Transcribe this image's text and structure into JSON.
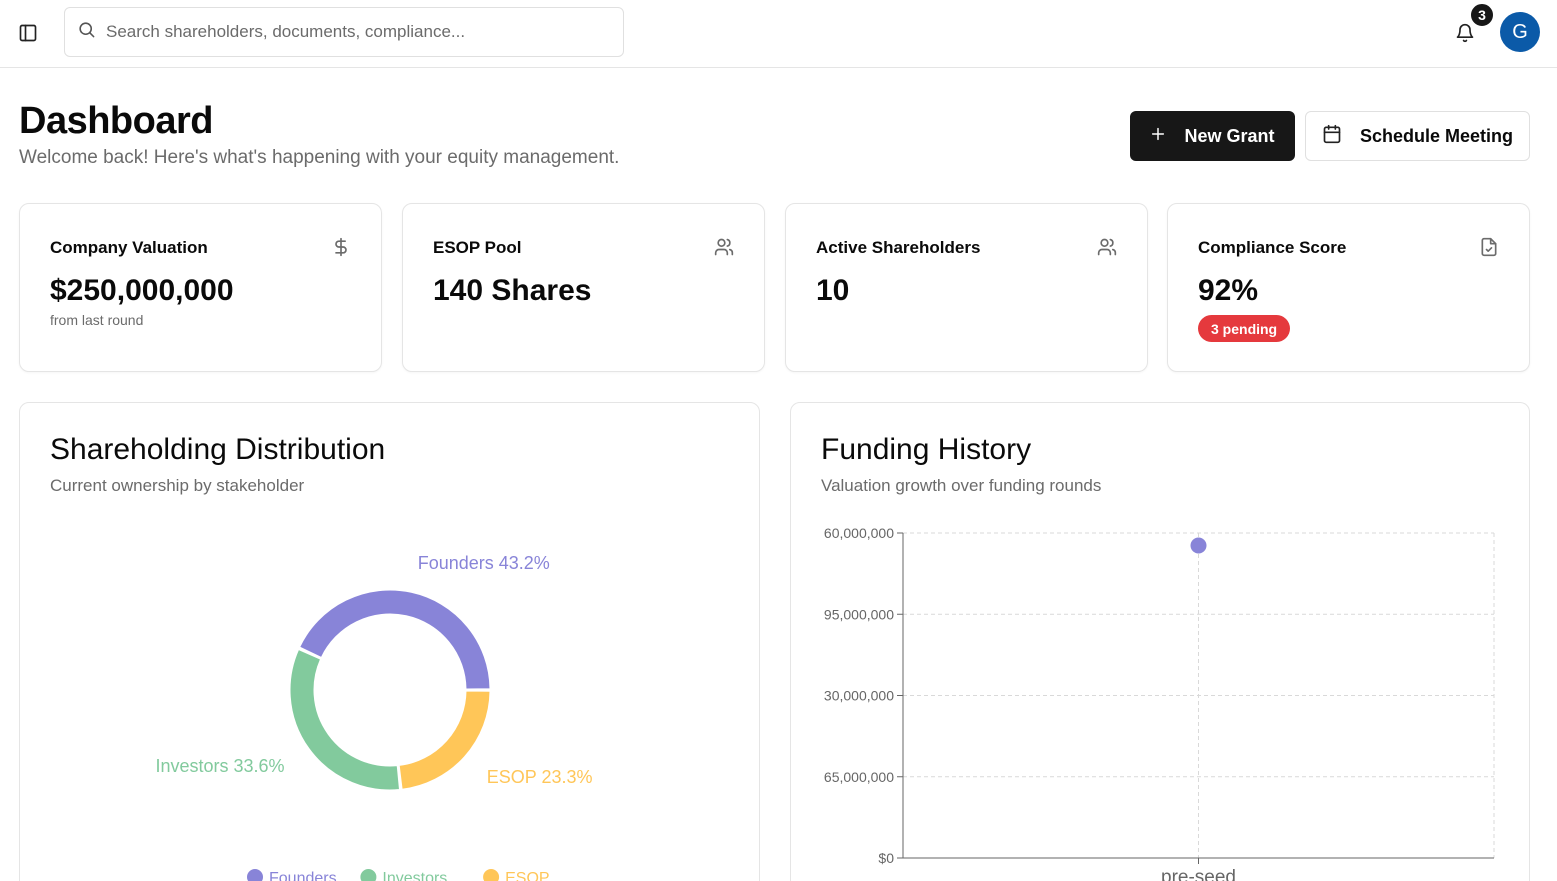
{
  "header": {
    "search_placeholder": "Search shareholders, documents, compliance...",
    "notification_count": "3",
    "avatar_initial": "G"
  },
  "page": {
    "title": "Dashboard",
    "subtitle": "Welcome back! Here's what's happening with your equity management.",
    "new_grant_label": "New Grant",
    "schedule_meeting_label": "Schedule Meeting"
  },
  "stats": [
    {
      "label": "Company Valuation",
      "value": "$250,000,000",
      "note": "from last round",
      "icon": "dollar-icon"
    },
    {
      "label": "ESOP Pool",
      "value": "140 Shares",
      "icon": "users-icon"
    },
    {
      "label": "Active Shareholders",
      "value": "10",
      "icon": "users-icon"
    },
    {
      "label": "Compliance Score",
      "value": "92%",
      "badge": "3 pending",
      "icon": "file-check-icon"
    }
  ],
  "colors": {
    "primary": "#171717",
    "danger": "#e5393d",
    "founders": "#8884d8",
    "investors": "#82ca9d",
    "esop": "#ffc658",
    "avatar": "#0b5aa8"
  },
  "panels": {
    "distribution": {
      "title": "Shareholding Distribution",
      "subtitle": "Current ownership by stakeholder"
    },
    "funding": {
      "title": "Funding History",
      "subtitle": "Valuation growth over funding rounds"
    }
  },
  "chart_data": [
    {
      "type": "pie",
      "title": "Shareholding Distribution",
      "slices": [
        {
          "name": "Founders",
          "value": 43.2,
          "label": "Founders 43.2%",
          "color": "#8884d8"
        },
        {
          "name": "Investors",
          "value": 33.6,
          "label": "Investors 33.6%",
          "color": "#82ca9d"
        },
        {
          "name": "ESOP",
          "value": 23.3,
          "label": "ESOP 23.3%",
          "color": "#ffc658"
        }
      ],
      "legend": [
        "Founders",
        "Investors",
        "ESOP"
      ],
      "legend_position": "bottom"
    },
    {
      "type": "line",
      "title": "Funding History",
      "categories": [
        "pre-seed"
      ],
      "y_tick_labels": [
        "$0",
        "65,000,000",
        "30,000,000",
        "95,000,000",
        "60,000,000"
      ],
      "series": [
        {
          "values": [
            250000000
          ],
          "color": "#8884d8"
        }
      ],
      "ylim": [
        0,
        260000000
      ],
      "grid": true
    }
  ]
}
